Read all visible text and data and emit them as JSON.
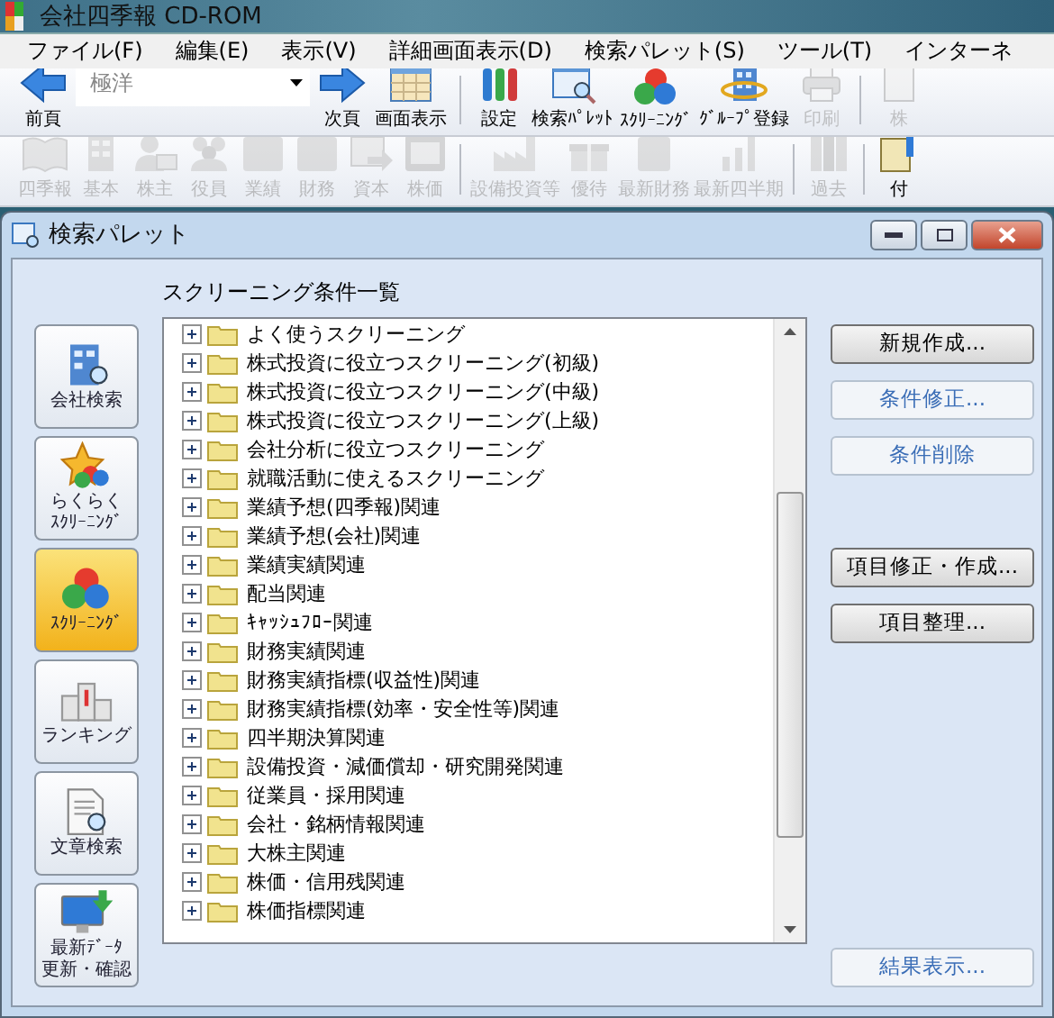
{
  "window": {
    "title": "会社四季報 CD-ROM"
  },
  "menu": [
    "ファイル(F)",
    "編集(E)",
    "表示(V)",
    "詳細画面表示(D)",
    "検索パレット(S)",
    "ツール(T)",
    "インターネ"
  ],
  "toolbar": {
    "back": {
      "label": "前頁",
      "disabled": false
    },
    "company_field": {
      "value": "極洋"
    },
    "items": [
      {
        "label": "次頁",
        "disabled": false
      },
      {
        "label": "画面表示",
        "disabled": false
      },
      {
        "label": "設定",
        "disabled": false
      },
      {
        "label": "検索ﾊﾟﾚｯﾄ",
        "disabled": false
      },
      {
        "label": "ｽｸﾘｰﾆﾝｸﾞ",
        "disabled": false
      },
      {
        "label": "ｸﾞﾙｰﾌﾟ登録",
        "disabled": false
      },
      {
        "label": "印刷",
        "disabled": true
      },
      {
        "label": "株",
        "disabled": true
      }
    ]
  },
  "toolbar2": [
    {
      "label": "四季報",
      "disabled": true
    },
    {
      "label": "基本",
      "disabled": true
    },
    {
      "label": "株主",
      "disabled": true
    },
    {
      "label": "役員",
      "disabled": true
    },
    {
      "label": "業績",
      "disabled": true
    },
    {
      "label": "財務",
      "disabled": true
    },
    {
      "label": "資本",
      "disabled": true
    },
    {
      "label": "株価",
      "disabled": true
    },
    {
      "label": "設備投資等",
      "disabled": true
    },
    {
      "label": "優待",
      "disabled": true
    },
    {
      "label": "最新財務",
      "disabled": true
    },
    {
      "label": "最新四半期",
      "disabled": true
    },
    {
      "label": "過去",
      "disabled": true
    },
    {
      "label": "付",
      "disabled": false
    }
  ],
  "palette": {
    "title": "検索パレット",
    "sidebar": [
      {
        "lines": [
          "会社検索"
        ],
        "selected": false
      },
      {
        "lines": [
          "らくらく",
          "ｽｸﾘｰﾆﾝｸﾞ"
        ],
        "selected": false
      },
      {
        "lines": [
          "ｽｸﾘｰﾆﾝｸﾞ"
        ],
        "selected": true
      },
      {
        "lines": [
          "ランキング"
        ],
        "selected": false
      },
      {
        "lines": [
          "文章検索"
        ],
        "selected": false
      },
      {
        "lines": [
          "最新ﾃﾞｰﾀ",
          "更新・確認"
        ],
        "selected": false
      }
    ],
    "list_title": "スクリーニング条件一覧",
    "tree": [
      {
        "label": "よく使うスクリーニング",
        "expanded": false
      },
      {
        "label": "株式投資に役立つスクリーニング(初級)",
        "expanded": false
      },
      {
        "label": "株式投資に役立つスクリーニング(中級)",
        "expanded": false
      },
      {
        "label": "株式投資に役立つスクリーニング(上級)",
        "expanded": false
      },
      {
        "label": "会社分析に役立つスクリーニング",
        "expanded": false
      },
      {
        "label": "就職活動に使えるスクリーニング",
        "expanded": false
      },
      {
        "label": "業績予想(四季報)関連",
        "expanded": false
      },
      {
        "label": "業績予想(会社)関連",
        "expanded": false
      },
      {
        "label": "業績実績関連",
        "expanded": false
      },
      {
        "label": "配当関連",
        "expanded": false
      },
      {
        "label": "ｷｬｯｼｭﾌﾛｰ関連",
        "expanded": false
      },
      {
        "label": "財務実績関連",
        "expanded": false
      },
      {
        "label": "財務実績指標(収益性)関連",
        "expanded": false
      },
      {
        "label": "財務実績指標(効率・安全性等)関連",
        "expanded": false
      },
      {
        "label": "四半期決算関連",
        "expanded": false
      },
      {
        "label": "設備投資・減価償却・研究開発関連",
        "expanded": false
      },
      {
        "label": "従業員・採用関連",
        "expanded": false
      },
      {
        "label": "会社・銘柄情報関連",
        "expanded": false
      },
      {
        "label": "大株主関連",
        "expanded": false
      },
      {
        "label": "株価・信用残関連",
        "expanded": false
      },
      {
        "label": "株価指標関連",
        "expanded": false
      }
    ],
    "button_groups": [
      [
        {
          "label": "新規作成...",
          "disabled": false
        },
        {
          "label": "条件修正...",
          "disabled": true
        },
        {
          "label": "条件削除",
          "disabled": true
        }
      ],
      [
        {
          "label": "項目修正・作成...",
          "disabled": false
        },
        {
          "label": "項目整理...",
          "disabled": false
        }
      ],
      [
        {
          "label": "結果表示...",
          "disabled": true
        }
      ]
    ]
  }
}
